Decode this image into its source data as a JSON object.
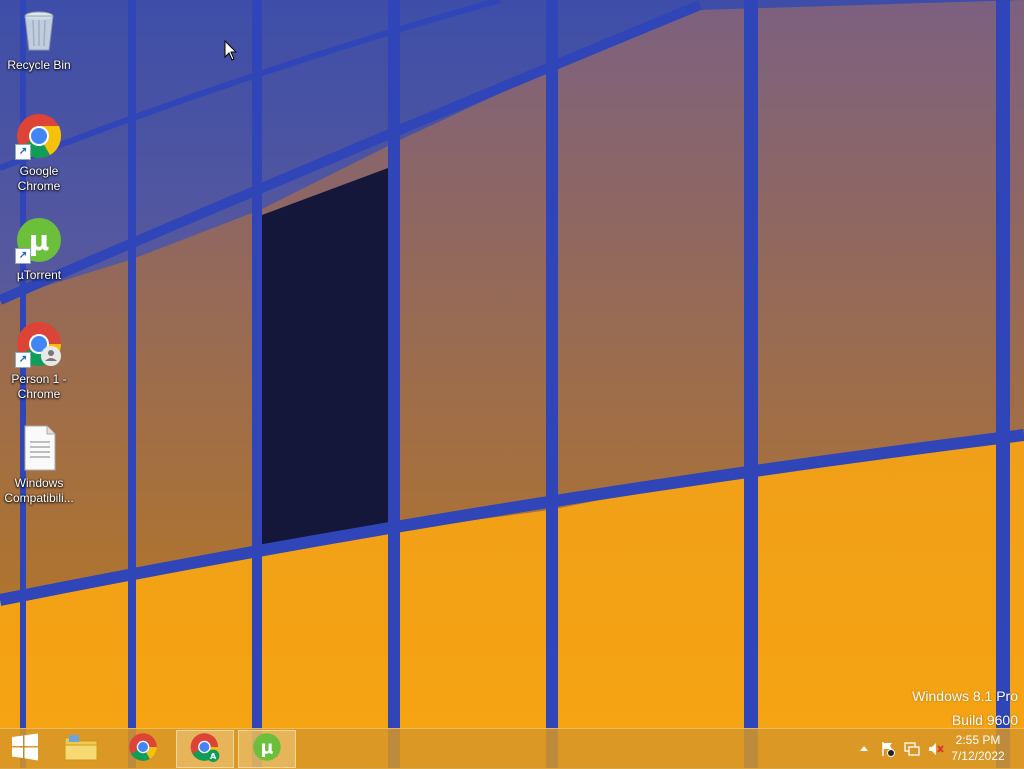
{
  "desktop": {
    "icons": [
      {
        "label": "Recycle Bin",
        "icon": "recycle-bin-icon"
      },
      {
        "label": "Google Chrome",
        "icon": "chrome-icon"
      },
      {
        "label": "µTorrent",
        "icon": "utorrent-icon"
      },
      {
        "label": "Person 1 - Chrome",
        "icon": "chrome-person-icon"
      },
      {
        "label": "Windows Compatibili...",
        "icon": "text-document-icon"
      }
    ]
  },
  "watermark": {
    "edition": "Windows 8.1 Pro",
    "build": "Build 9600"
  },
  "taskbar": {
    "start": {
      "icon": "windows-logo-icon"
    },
    "apps": [
      {
        "name": "File Explorer",
        "icon": "folder-icon",
        "running": false
      },
      {
        "name": "Google Chrome",
        "icon": "chrome-icon",
        "running": false
      },
      {
        "name": "Chrome (Person)",
        "icon": "chrome-person-icon",
        "running": true
      },
      {
        "name": "µTorrent",
        "icon": "utorrent-icon",
        "running": true
      }
    ],
    "tray": {
      "icons": [
        "show-hidden-icons-arrow",
        "action-center-flag-icon",
        "network-icon",
        "volume-muted-icon"
      ],
      "time": "2:55 PM",
      "date": "7/12/2022"
    }
  },
  "colors": {
    "wallpaper_blue": "#2f45b8",
    "wallpaper_orange": "#f6a412",
    "taskbar": "#d69628",
    "chrome_red": "#db4437",
    "chrome_yellow": "#f4c20d",
    "chrome_green": "#0f9d58",
    "chrome_blue": "#4285f4",
    "utorrent_green": "#6cbf3a"
  }
}
